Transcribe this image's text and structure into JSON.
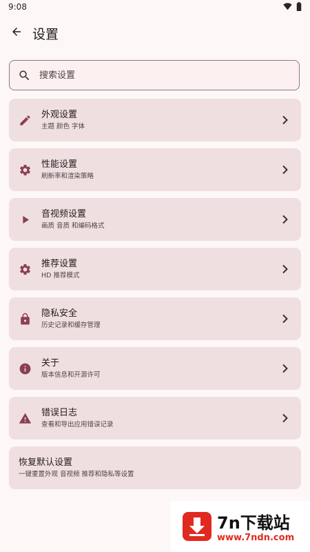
{
  "status_bar": {
    "time": "9:08",
    "icons": [
      "wifi-icon",
      "battery-icon"
    ]
  },
  "app_bar": {
    "back_icon": "arrow-left-icon",
    "title": "设置"
  },
  "search": {
    "icon": "search-icon",
    "placeholder": "搜索设置",
    "value": ""
  },
  "settings": [
    {
      "icon": "pencil-icon",
      "title": "外观设置",
      "subtitle": "主题 颜色 字体"
    },
    {
      "icon": "gear-icon",
      "title": "性能设置",
      "subtitle": "刷新率和渲染策略"
    },
    {
      "icon": "play-icon",
      "title": "音视频设置",
      "subtitle": "画质 音质 和编码格式"
    },
    {
      "icon": "gear-icon",
      "title": "推荐设置",
      "subtitle": "HD 推荐模式"
    },
    {
      "icon": "lock-icon",
      "title": "隐私安全",
      "subtitle": "历史记录和缓存管理"
    },
    {
      "icon": "info-icon",
      "title": "关于",
      "subtitle": "版本信息和开源许可"
    },
    {
      "icon": "warning-icon",
      "title": "错误日志",
      "subtitle": "查看和导出应用错误记录"
    }
  ],
  "reset": {
    "title": "恢复默认设置",
    "subtitle": "一键重置外观 音视频 推荐和隐私等设置"
  },
  "watermark": {
    "title": "7n下载站",
    "url": "www.7ndn.com"
  },
  "colors": {
    "background": "#fdf7f7",
    "card": "#f0dfe1",
    "icon": "#8a3f55",
    "watermark_red": "#e02a1f"
  }
}
